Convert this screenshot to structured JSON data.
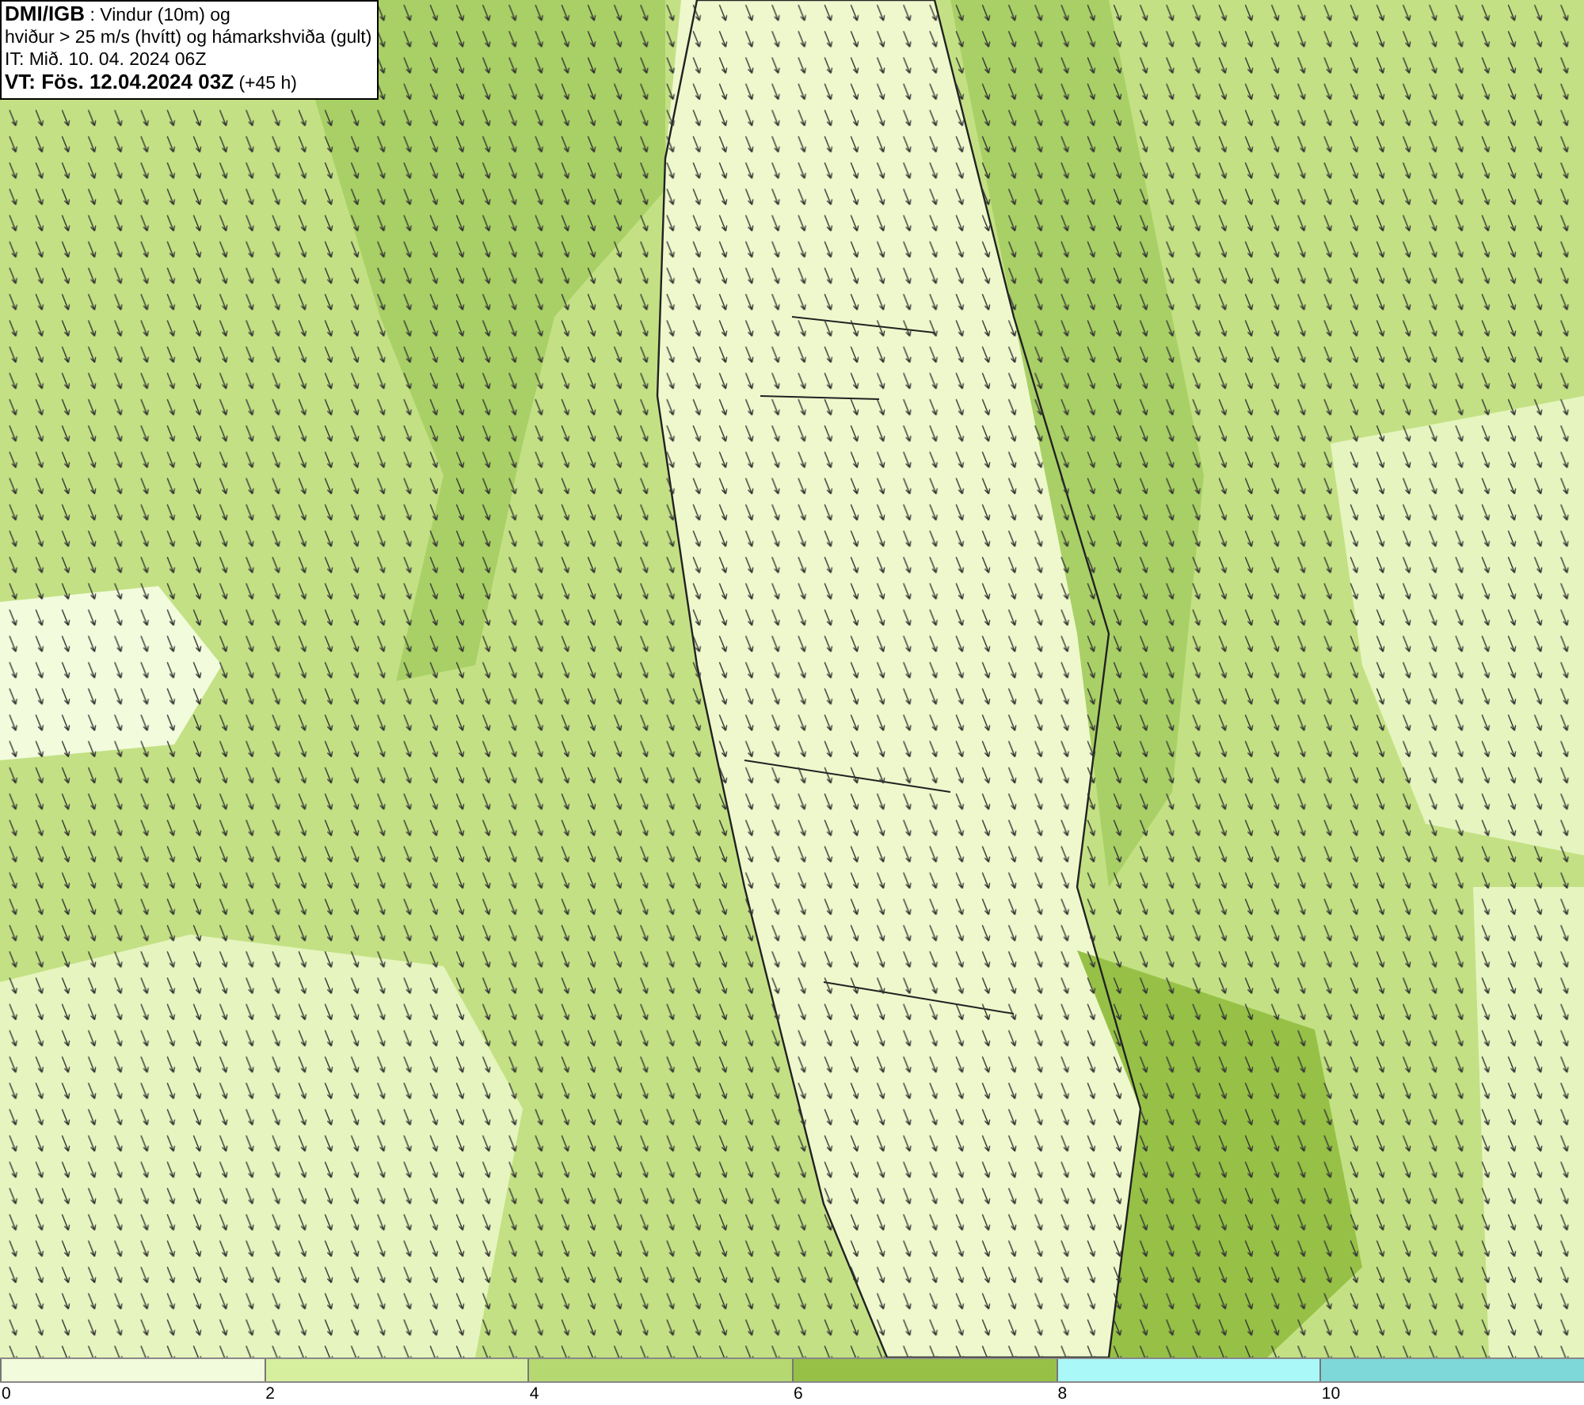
{
  "title_box": {
    "lines": [
      "**DMI/IGB** : Vindur (10m) og",
      "hviður > 25 m/s (hvítt) og hámarkshviða (gult)",
      "IT: Mið. 10. 04. 2024 06Z",
      "**VT: Fös. 12.04.2024 03Z** (+45 h)"
    ]
  },
  "legend": {
    "segments": [
      {
        "color": "#f2fbdc",
        "tick": "0"
      },
      {
        "color": "#d6ef9f",
        "tick": "2"
      },
      {
        "color": "#b5d970",
        "tick": "4"
      },
      {
        "color": "#96c146",
        "tick": "6"
      },
      {
        "color": "#aaf8f8",
        "tick": "8"
      },
      {
        "color": "#7ed8da",
        "tick": "10"
      }
    ]
  }
}
